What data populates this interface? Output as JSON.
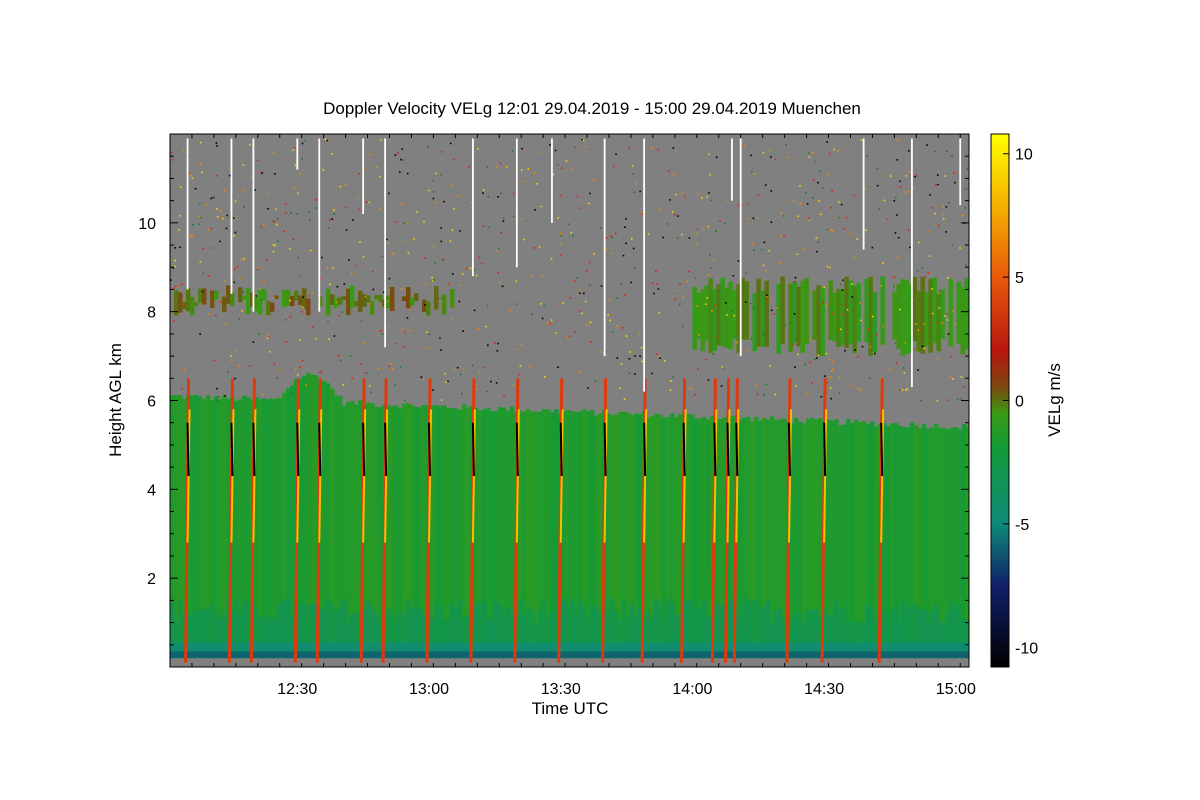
{
  "chart_data": {
    "type": "heatmap",
    "title": "Doppler Velocity VELg   12:01 29.04.2019 - 15:00 29.04.2019 Muenchen",
    "xlabel": "Time UTC",
    "ylabel": "Height AGL km",
    "colorbar_label": "VELg m/s",
    "x_range_minutes": [
      721,
      903
    ],
    "xlim_labels": [
      "12:01",
      "15:00"
    ],
    "x_ticks": [
      {
        "minute": 750,
        "label": "12:30"
      },
      {
        "minute": 780,
        "label": "13:00"
      },
      {
        "minute": 810,
        "label": "13:30"
      },
      {
        "minute": 840,
        "label": "14:00"
      },
      {
        "minute": 870,
        "label": "14:30"
      },
      {
        "minute": 900,
        "label": "15:00"
      }
    ],
    "y_range_km": [
      0,
      12
    ],
    "y_ticks": [
      {
        "value": 2,
        "label": "2"
      },
      {
        "value": 4,
        "label": "4"
      },
      {
        "value": 6,
        "label": "6"
      },
      {
        "value": 8,
        "label": "8"
      },
      {
        "value": 10,
        "label": "10"
      }
    ],
    "colorbar_range": [
      -10.8,
      10.8
    ],
    "colorbar_ticks": [
      {
        "value": 10,
        "label": "10"
      },
      {
        "value": 5,
        "label": "5"
      },
      {
        "value": 0,
        "label": "0"
      },
      {
        "value": -5,
        "label": "-5"
      },
      {
        "value": -10,
        "label": "-10"
      }
    ],
    "colormap_stops": [
      {
        "value": -10.8,
        "color": "#000000"
      },
      {
        "value": -7.5,
        "color": "#10206a"
      },
      {
        "value": -5,
        "color": "#0f8a78"
      },
      {
        "value": -2,
        "color": "#139a3a"
      },
      {
        "value": -0.5,
        "color": "#3a9a14"
      },
      {
        "value": 0.5,
        "color": "#7a4a10"
      },
      {
        "value": 2,
        "color": "#b8160e"
      },
      {
        "value": 5,
        "color": "#e85a0a"
      },
      {
        "value": 8,
        "color": "#f5b400"
      },
      {
        "value": 10.8,
        "color": "#ffff00"
      }
    ],
    "no_signal_color": "#808080",
    "regions": [
      {
        "name": "lower-cloud-bottom-layer",
        "h_range": [
          0.2,
          0.55
        ],
        "velocity": -4.5
      },
      {
        "name": "lower-cloud-base",
        "h_range": [
          0.55,
          2.0
        ],
        "velocity": -3.2
      },
      {
        "name": "lower-cloud-main",
        "top_km_start": 6.1,
        "top_km_end": 5.4,
        "velocity": -1.5
      },
      {
        "name": "upper-cloud-layer-1",
        "time_range": [
          721,
          785
        ],
        "h_range": [
          7.9,
          8.6
        ],
        "velocity": 0.0
      },
      {
        "name": "upper-cloud-layer-2",
        "time_range": [
          840,
          903
        ],
        "h_range": [
          7.0,
          8.8
        ],
        "velocity": -0.5
      }
    ],
    "fall_streaks_minutes": [
      725,
      735,
      740,
      750,
      755,
      765,
      770,
      780,
      790,
      800,
      810,
      820,
      829,
      838,
      845,
      848,
      850,
      862,
      870,
      883
    ],
    "white_streaks": [
      {
        "minute": 725,
        "top_km": 11.9,
        "bottom_km": 8.5
      },
      {
        "minute": 735,
        "top_km": 11.9,
        "bottom_km": 8.4
      },
      {
        "minute": 740,
        "top_km": 11.9,
        "bottom_km": 8.0
      },
      {
        "minute": 750,
        "top_km": 11.9,
        "bottom_km": 11.2
      },
      {
        "minute": 755,
        "top_km": 11.9,
        "bottom_km": 8.0
      },
      {
        "minute": 765,
        "top_km": 11.9,
        "bottom_km": 10.2
      },
      {
        "minute": 770,
        "top_km": 11.9,
        "bottom_km": 7.2
      },
      {
        "minute": 790,
        "top_km": 11.9,
        "bottom_km": 8.8
      },
      {
        "minute": 800,
        "top_km": 11.9,
        "bottom_km": 9.0
      },
      {
        "minute": 808,
        "top_km": 11.9,
        "bottom_km": 10.0
      },
      {
        "minute": 820,
        "top_km": 11.9,
        "bottom_km": 7.0
      },
      {
        "minute": 829,
        "top_km": 11.9,
        "bottom_km": 6.2
      },
      {
        "minute": 849,
        "top_km": 11.9,
        "bottom_km": 10.5
      },
      {
        "minute": 851,
        "top_km": 11.9,
        "bottom_km": 7.0
      },
      {
        "minute": 879,
        "top_km": 11.9,
        "bottom_km": 9.4
      },
      {
        "minute": 890,
        "top_km": 11.9,
        "bottom_km": 6.3
      },
      {
        "minute": 901,
        "top_km": 11.9,
        "bottom_km": 10.4
      }
    ]
  }
}
